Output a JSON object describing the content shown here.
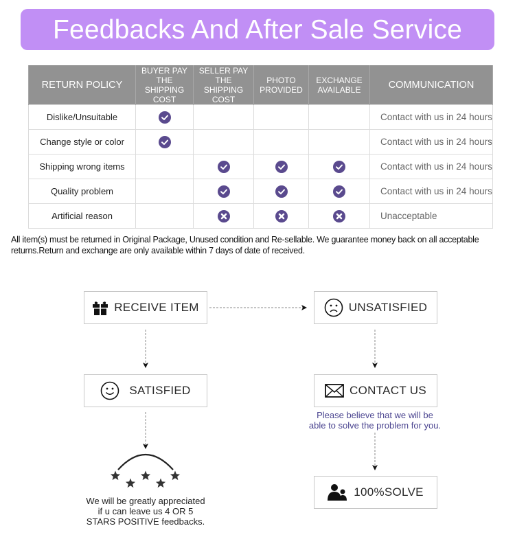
{
  "banner": {
    "title": "Feedbacks And After Sale Service"
  },
  "policy_table": {
    "headers": [
      "RETURN POLICY",
      "BUYER PAY THE SHIPPING COST",
      "SELLER PAY THE SHIPPING COST",
      "PHOTO PROVIDED",
      "EXCHANGE AVAILABLE",
      "COMMUNICATION"
    ],
    "header_lines": [
      [
        "RETURN POLICY"
      ],
      [
        "BUYER PAY",
        "THE SHIPPING",
        "COST"
      ],
      [
        "SELLER PAY",
        "THE SHIPPING",
        "COST"
      ],
      [
        "PHOTO",
        "PROVIDED"
      ],
      [
        "EXCHANGE",
        "AVAILABLE"
      ],
      [
        "COMMUNICATION"
      ]
    ],
    "rows": [
      {
        "reason": "Dislike/Unsuitable",
        "buyer_pay": "check",
        "seller_pay": "",
        "photo": "",
        "exchange": "",
        "communication": "Contact with us in 24 hours"
      },
      {
        "reason": "Change style or color",
        "buyer_pay": "check",
        "seller_pay": "",
        "photo": "",
        "exchange": "",
        "communication": "Contact with us in 24 hours"
      },
      {
        "reason": "Shipping wrong items",
        "buyer_pay": "",
        "seller_pay": "check",
        "photo": "check",
        "exchange": "check",
        "communication": "Contact with us in 24 hours"
      },
      {
        "reason": "Quality problem",
        "buyer_pay": "",
        "seller_pay": "check",
        "photo": "check",
        "exchange": "check",
        "communication": "Contact with us in 24 hours"
      },
      {
        "reason": "Artificial reason",
        "buyer_pay": "",
        "seller_pay": "cross",
        "photo": "cross",
        "exchange": "cross",
        "communication": "Unacceptable"
      }
    ]
  },
  "notice": "All item(s) must be returned in Original Package, Unused condition and Re-sellable. We guarantee money back on all acceptable returns.Return and exchange are only available within 7 days of date of received.",
  "flow": {
    "receive_item": {
      "label": "RECEIVE ITEM",
      "icon": "gift-icon"
    },
    "unsatisfied": {
      "label": "UNSATISFIED",
      "icon": "sad-face-icon"
    },
    "satisfied": {
      "label": "SATISFIED",
      "icon": "smiley-face-icon"
    },
    "contact_us": {
      "label": "CONTACT US",
      "icon": "envelope-icon",
      "note_lines": [
        "Please believe that we will be",
        "able to solve the problem for you."
      ]
    },
    "solve": {
      "label": "100%SOLVE",
      "icon": "users-icon"
    },
    "feedback": {
      "icon": "five-stars-icon",
      "note_lines": [
        "We will be greatly appreciated",
        "if u can leave us 4 OR 5",
        "STARS POSITIVE feedbacks."
      ]
    }
  },
  "colors": {
    "banner": "#c18ff5",
    "header": "#929292",
    "mark": "#5a4a8e",
    "note": "#4b4590"
  }
}
